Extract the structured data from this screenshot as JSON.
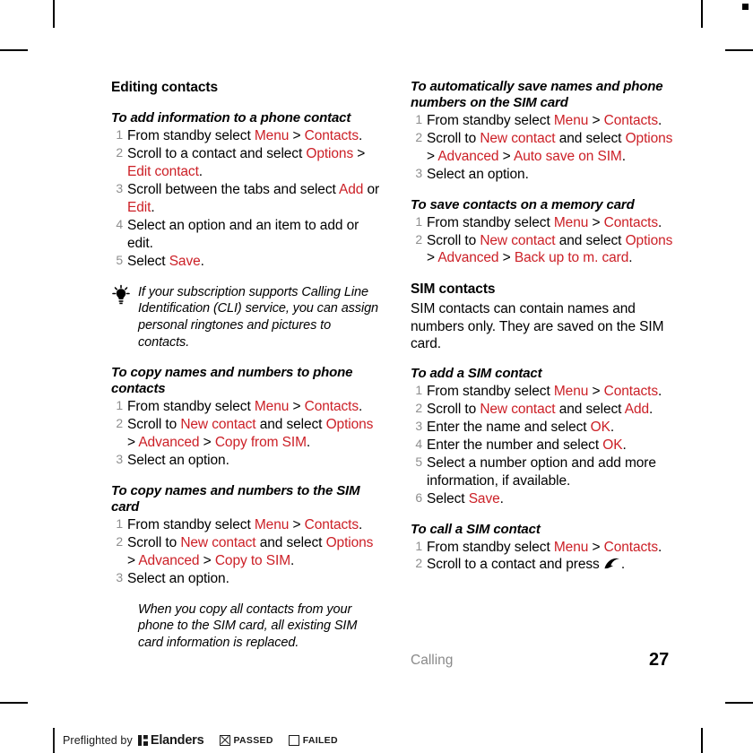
{
  "colors": {
    "ui_term_red": "#cc2027",
    "step_number_gray": "#8e8e8e",
    "footer_gray": "#8a8a8a"
  },
  "left_column": {
    "section_heading": "Editing contacts",
    "tasks": [
      {
        "heading": "To add information to a phone contact",
        "steps": [
          [
            {
              "t": "From standby select ",
              "c": "k"
            },
            {
              "t": "Menu",
              "c": "r"
            },
            {
              "t": " > ",
              "c": "k"
            },
            {
              "t": "Contacts",
              "c": "r"
            },
            {
              "t": ".",
              "c": "k"
            }
          ],
          [
            {
              "t": "Scroll to a contact and select ",
              "c": "k"
            },
            {
              "t": "Options",
              "c": "r"
            },
            {
              "t": " > ",
              "c": "k"
            },
            {
              "t": "Edit contact",
              "c": "r"
            },
            {
              "t": ".",
              "c": "k"
            }
          ],
          [
            {
              "t": "Scroll between the tabs and select ",
              "c": "k"
            },
            {
              "t": "Add",
              "c": "r"
            },
            {
              "t": " or ",
              "c": "k"
            },
            {
              "t": "Edit",
              "c": "r"
            },
            {
              "t": ".",
              "c": "k"
            }
          ],
          [
            {
              "t": "Select an option and an item to add or edit.",
              "c": "k"
            }
          ],
          [
            {
              "t": "Select ",
              "c": "k"
            },
            {
              "t": "Save",
              "c": "r"
            },
            {
              "t": ".",
              "c": "k"
            }
          ]
        ]
      }
    ],
    "tip": {
      "icon": "lightbulb-icon",
      "text": "If your subscription supports Calling Line Identification (CLI) service, you can assign personal ringtones and pictures to contacts."
    },
    "tasks2": [
      {
        "heading": "To copy names and numbers to phone contacts",
        "steps": [
          [
            {
              "t": "From standby select ",
              "c": "k"
            },
            {
              "t": "Menu",
              "c": "r"
            },
            {
              "t": " > ",
              "c": "k"
            },
            {
              "t": "Contacts",
              "c": "r"
            },
            {
              "t": ".",
              "c": "k"
            }
          ],
          [
            {
              "t": "Scroll to ",
              "c": "k"
            },
            {
              "t": "New contact",
              "c": "r"
            },
            {
              "t": " and select ",
              "c": "k"
            },
            {
              "t": "Options",
              "c": "r"
            },
            {
              "t": " > ",
              "c": "k"
            },
            {
              "t": "Advanced",
              "c": "r"
            },
            {
              "t": " > ",
              "c": "k"
            },
            {
              "t": "Copy from SIM",
              "c": "r"
            },
            {
              "t": ".",
              "c": "k"
            }
          ],
          [
            {
              "t": "Select an option.",
              "c": "k"
            }
          ]
        ]
      },
      {
        "heading": "To copy names and numbers to the SIM card",
        "steps": [
          [
            {
              "t": "From standby select ",
              "c": "k"
            },
            {
              "t": "Menu",
              "c": "r"
            },
            {
              "t": " > ",
              "c": "k"
            },
            {
              "t": "Contacts",
              "c": "r"
            },
            {
              "t": ".",
              "c": "k"
            }
          ],
          [
            {
              "t": "Scroll to ",
              "c": "k"
            },
            {
              "t": "New contact",
              "c": "r"
            },
            {
              "t": " and select ",
              "c": "k"
            },
            {
              "t": "Options",
              "c": "r"
            },
            {
              "t": " > ",
              "c": "k"
            },
            {
              "t": "Advanced",
              "c": "r"
            },
            {
              "t": " > ",
              "c": "k"
            },
            {
              "t": "Copy to SIM",
              "c": "r"
            },
            {
              "t": ".",
              "c": "k"
            }
          ],
          [
            {
              "t": "Select an option.",
              "c": "k"
            }
          ]
        ]
      }
    ],
    "note": {
      "icon": "exclamation-icon",
      "text": "When you copy all contacts from your phone to the SIM card, all existing SIM card information is replaced."
    }
  },
  "right_column": {
    "tasks": [
      {
        "heading": "To automatically save names and phone numbers on the SIM card",
        "steps": [
          [
            {
              "t": "From standby select ",
              "c": "k"
            },
            {
              "t": "Menu",
              "c": "r"
            },
            {
              "t": " > ",
              "c": "k"
            },
            {
              "t": "Contacts",
              "c": "r"
            },
            {
              "t": ".",
              "c": "k"
            }
          ],
          [
            {
              "t": "Scroll to ",
              "c": "k"
            },
            {
              "t": "New contact",
              "c": "r"
            },
            {
              "t": " and select ",
              "c": "k"
            },
            {
              "t": "Options",
              "c": "r"
            },
            {
              "t": " > ",
              "c": "k"
            },
            {
              "t": "Advanced",
              "c": "r"
            },
            {
              "t": " > ",
              "c": "k"
            },
            {
              "t": "Auto save on SIM",
              "c": "r"
            },
            {
              "t": ".",
              "c": "k"
            }
          ],
          [
            {
              "t": "Select an option.",
              "c": "k"
            }
          ]
        ]
      },
      {
        "heading": "To save contacts on a memory card",
        "steps": [
          [
            {
              "t": "From standby select ",
              "c": "k"
            },
            {
              "t": "Menu",
              "c": "r"
            },
            {
              "t": " > ",
              "c": "k"
            },
            {
              "t": "Contacts",
              "c": "r"
            },
            {
              "t": ".",
              "c": "k"
            }
          ],
          [
            {
              "t": "Scroll to ",
              "c": "k"
            },
            {
              "t": "New contact",
              "c": "r"
            },
            {
              "t": " and select ",
              "c": "k"
            },
            {
              "t": "Options",
              "c": "r"
            },
            {
              "t": " > ",
              "c": "k"
            },
            {
              "t": "Advanced",
              "c": "r"
            },
            {
              "t": " > ",
              "c": "k"
            },
            {
              "t": "Back up to m. card",
              "c": "r"
            },
            {
              "t": ".",
              "c": "k"
            }
          ]
        ]
      }
    ],
    "sim_section": {
      "heading": "SIM contacts",
      "body": "SIM contacts can contain names and numbers only. They are saved on the SIM card."
    },
    "tasks2": [
      {
        "heading": "To add a SIM contact",
        "steps": [
          [
            {
              "t": "From standby select ",
              "c": "k"
            },
            {
              "t": "Menu",
              "c": "r"
            },
            {
              "t": " > ",
              "c": "k"
            },
            {
              "t": "Contacts",
              "c": "r"
            },
            {
              "t": ".",
              "c": "k"
            }
          ],
          [
            {
              "t": "Scroll to ",
              "c": "k"
            },
            {
              "t": "New contact",
              "c": "r"
            },
            {
              "t": " and select ",
              "c": "k"
            },
            {
              "t": "Add",
              "c": "r"
            },
            {
              "t": ".",
              "c": "k"
            }
          ],
          [
            {
              "t": "Enter the name and select ",
              "c": "k"
            },
            {
              "t": "OK",
              "c": "r"
            },
            {
              "t": ".",
              "c": "k"
            }
          ],
          [
            {
              "t": "Enter the number and select ",
              "c": "k"
            },
            {
              "t": "OK",
              "c": "r"
            },
            {
              "t": ".",
              "c": "k"
            }
          ],
          [
            {
              "t": "Select a number option and add more information, if available.",
              "c": "k"
            }
          ],
          [
            {
              "t": "Select ",
              "c": "k"
            },
            {
              "t": "Save",
              "c": "r"
            },
            {
              "t": ".",
              "c": "k"
            }
          ]
        ]
      },
      {
        "heading": "To call a SIM contact",
        "steps": [
          [
            {
              "t": "From standby select ",
              "c": "k"
            },
            {
              "t": "Menu",
              "c": "r"
            },
            {
              "t": " > ",
              "c": "k"
            },
            {
              "t": "Contacts",
              "c": "r"
            },
            {
              "t": ".",
              "c": "k"
            }
          ],
          [
            {
              "t": "Scroll to a contact and press ",
              "c": "k"
            },
            {
              "t": "",
              "c": "icon-call"
            },
            {
              "t": ".",
              "c": "k"
            }
          ]
        ]
      }
    ]
  },
  "footer": {
    "section_label": "Calling",
    "page_number": "27"
  },
  "preflight": {
    "prefix": "Preflighted by",
    "logo_text": "Elanders",
    "passed_label": "PASSED",
    "passed_checked": true,
    "failed_label": "FAILED",
    "failed_checked": false
  }
}
